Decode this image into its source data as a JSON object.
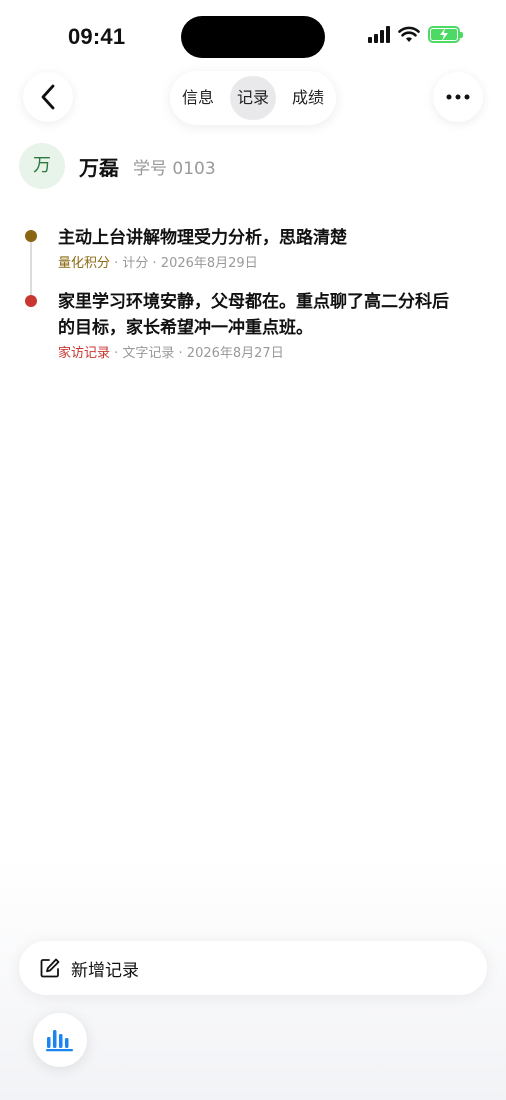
{
  "status_bar": {
    "time": "09:41"
  },
  "tabs": [
    {
      "label": "信息"
    },
    {
      "label": "记录"
    },
    {
      "label": "成绩"
    }
  ],
  "active_tab": "记录",
  "student": {
    "avatar_char": "万",
    "name": "万磊",
    "id_label": "学号 0103"
  },
  "records": [
    {
      "title": "主动上台讲解物理受力分析，思路清楚",
      "category": "量化积分",
      "category_color": "#8a6a12",
      "dot_color": "#8a6512",
      "detail": " · 计分 · 2026年8月29日"
    },
    {
      "title": "家里学习环境安静，父母都在。重点聊了高二分科后的目标，家长希望冲一冲重点班。",
      "category": "家访记录",
      "category_color": "#c8372f",
      "dot_color": "#c8372f",
      "detail": " · 文字记录 · 2026年8月27日"
    }
  ],
  "add_record": {
    "label": "新增记录"
  },
  "icons": {
    "back": "chevron-left-icon",
    "more": "ellipsis-icon",
    "add": "edit-icon",
    "stats": "bar-chart-icon"
  },
  "colors": {
    "accent_blue": "#1a84f0",
    "battery_green": "#4cd964"
  }
}
